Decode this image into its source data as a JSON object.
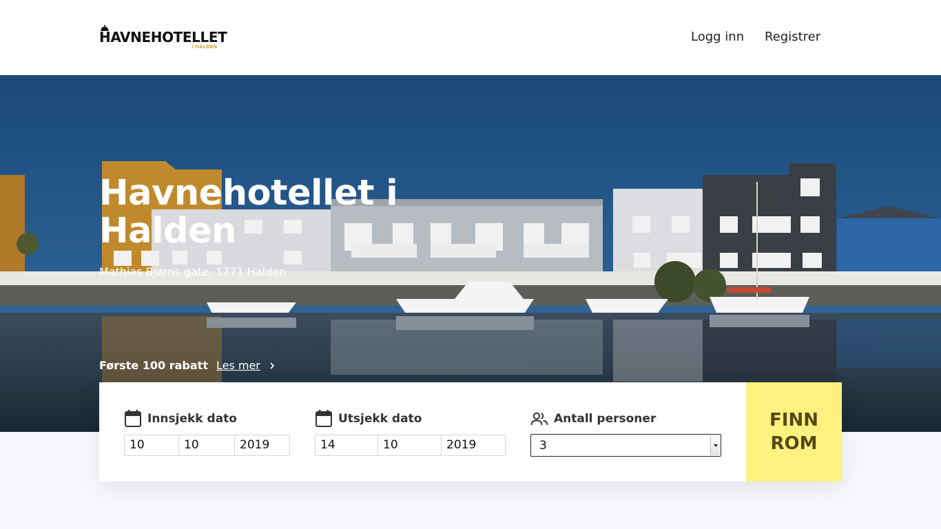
{
  "header": {
    "logo": {
      "text": "HAVNEHOTELLET",
      "subtext": "I HALDEN",
      "icon": "bell-icon"
    },
    "nav": {
      "login_label": "Logg inn",
      "register_label": "Registrer"
    }
  },
  "hero": {
    "title": "Havnehotellet i Halden",
    "address": "Mathias Bjørns gate, 1771 Halden",
    "promo": {
      "text": "Første 100 rabatt",
      "link_label": "Les mer",
      "link_icon": "chevron-right-icon"
    }
  },
  "booking": {
    "checkin": {
      "label": "Innsjekk dato",
      "icon": "calendar-icon",
      "day": "10",
      "month": "10",
      "year": "2019"
    },
    "checkout": {
      "label": "Utsjekk dato",
      "icon": "calendar-icon",
      "day": "14",
      "month": "10",
      "year": "2019"
    },
    "persons": {
      "label": "Antall personer",
      "icon": "people-icon",
      "value": "3"
    },
    "submit_label": "FINN ROM"
  },
  "colors": {
    "accent_button": "#fdf27f",
    "button_text": "#5a4718",
    "logo_accent": "#c29a1b",
    "sky": "#1e4f82"
  }
}
